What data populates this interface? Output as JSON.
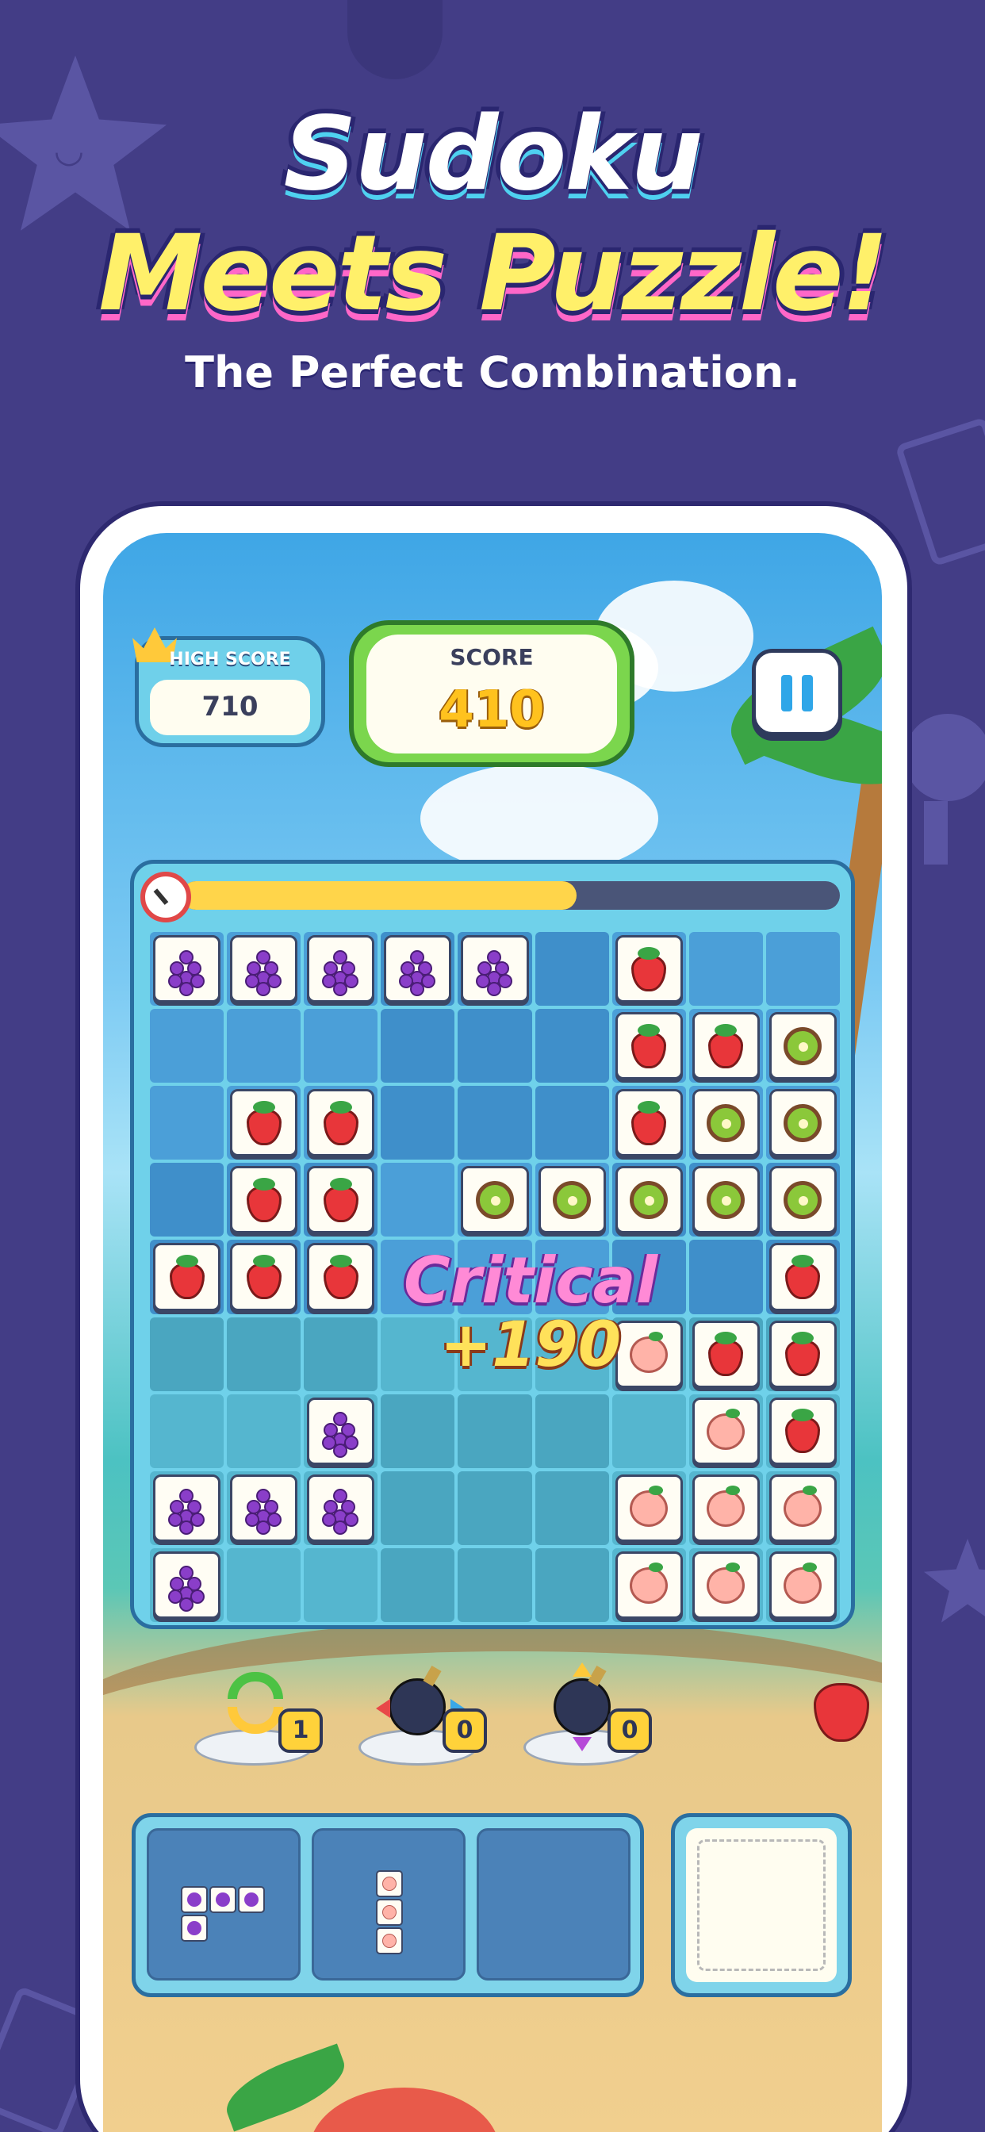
{
  "title": {
    "line1": "Sudoku",
    "line2": "Meets Puzzle!",
    "tagline": "The Perfect Combination."
  },
  "hud": {
    "high_score_label": "HIGH SCORE",
    "high_score_value": "710",
    "score_label": "SCORE",
    "score_value": "410",
    "pause_icon": "pause-icon"
  },
  "timer": {
    "icon": "clock-icon",
    "fraction_remaining": 0.6
  },
  "board": {
    "rows": [
      [
        "grape",
        "grape",
        "grape",
        "grape",
        "grape",
        "",
        "strawberry",
        "",
        ""
      ],
      [
        "",
        "",
        "",
        "",
        "",
        "",
        "strawberry",
        "strawberry",
        "kiwi"
      ],
      [
        "",
        "strawberry",
        "strawberry",
        "",
        "",
        "",
        "strawberry",
        "kiwi",
        "kiwi"
      ],
      [
        "",
        "strawberry",
        "strawberry",
        "",
        "kiwi",
        "kiwi",
        "kiwi",
        "kiwi",
        "kiwi"
      ],
      [
        "strawberry",
        "strawberry",
        "strawberry",
        "",
        "",
        "",
        "",
        "",
        "strawberry"
      ],
      [
        "",
        "",
        "",
        "",
        "",
        "",
        "peach",
        "strawberry",
        "strawberry"
      ],
      [
        "",
        "",
        "grape",
        "",
        "",
        "",
        "",
        "peach",
        "strawberry"
      ],
      [
        "grape",
        "grape",
        "grape",
        "",
        "",
        "",
        "peach",
        "peach",
        "peach"
      ],
      [
        "grape",
        "",
        "",
        "",
        "",
        "",
        "peach",
        "peach",
        "peach"
      ]
    ],
    "popup_line1": "Critical",
    "popup_line2": "+190"
  },
  "boosters": [
    {
      "name": "shuffle",
      "icon": "refresh-icon",
      "count": "1"
    },
    {
      "name": "bomb-horizontal",
      "icon": "bomb-horizontal-icon",
      "count": "0"
    },
    {
      "name": "bomb-vertical",
      "icon": "bomb-vertical-icon",
      "count": "0"
    }
  ],
  "tray": {
    "pieces": [
      {
        "fruit": "grape",
        "shape": "L-shape 3 over 1"
      },
      {
        "fruit": "peach",
        "shape": "vertical 3"
      },
      {
        "fruit": "",
        "shape": "empty"
      }
    ],
    "hold_slot": "empty"
  },
  "colors": {
    "background": "#433d86",
    "title_white": "#ffffff",
    "title_yellow": "#fff06a",
    "score_gold": "#ffc21e",
    "score_frame_green": "#7bd64d",
    "board_frame": "#6fd1ea",
    "timer_fill": "#ffd54a"
  }
}
